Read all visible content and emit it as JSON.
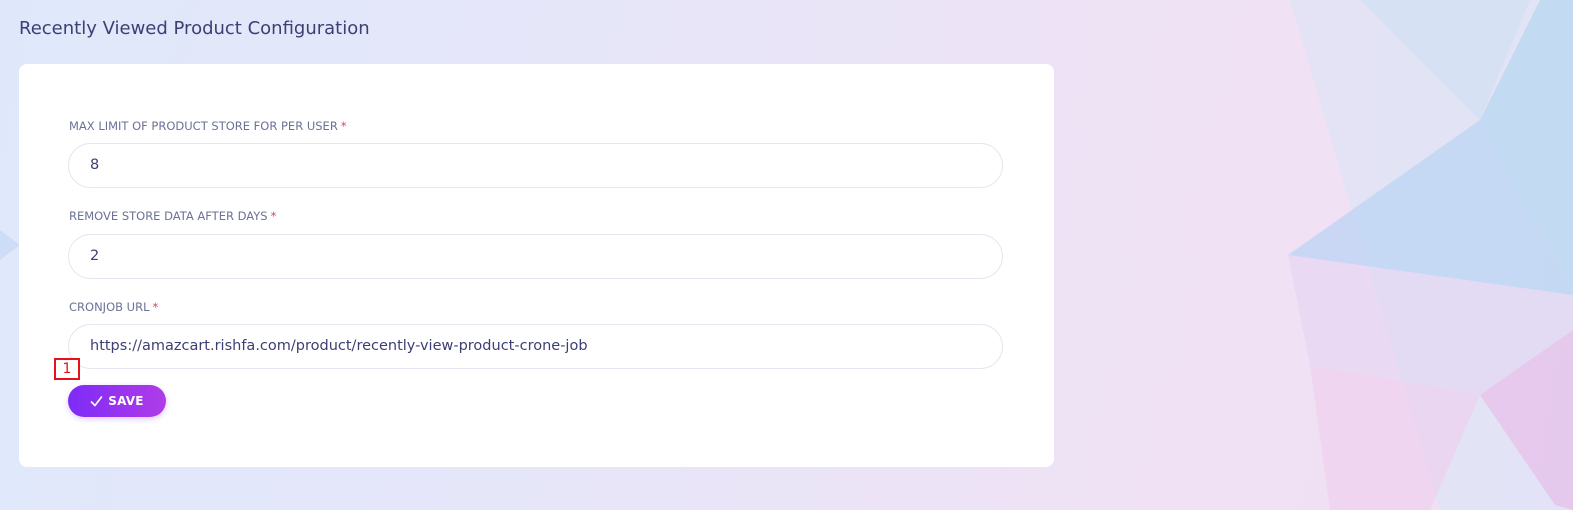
{
  "page": {
    "title": "Recently Viewed Product Configuration"
  },
  "form": {
    "fields": [
      {
        "label": "MAX LIMIT OF PRODUCT STORE FOR PER USER",
        "required_mark": "*",
        "value": "8"
      },
      {
        "label": "REMOVE STORE DATA AFTER DAYS",
        "required_mark": "*",
        "value": "2"
      },
      {
        "label": "CRONJOB URL",
        "required_mark": "*",
        "value": "https://amazcart.rishfa.com/product/recently-view-product-crone-job"
      }
    ],
    "save_button": {
      "label": "SAVE",
      "icon": "check-icon"
    }
  },
  "overlay": {
    "marker_label": "1"
  },
  "colors": {
    "accent_start": "#7d2bf7",
    "accent_end": "#b03ce8",
    "title_text": "#3c3f74",
    "required": "#e23d5a",
    "marker": "#e8111a"
  }
}
